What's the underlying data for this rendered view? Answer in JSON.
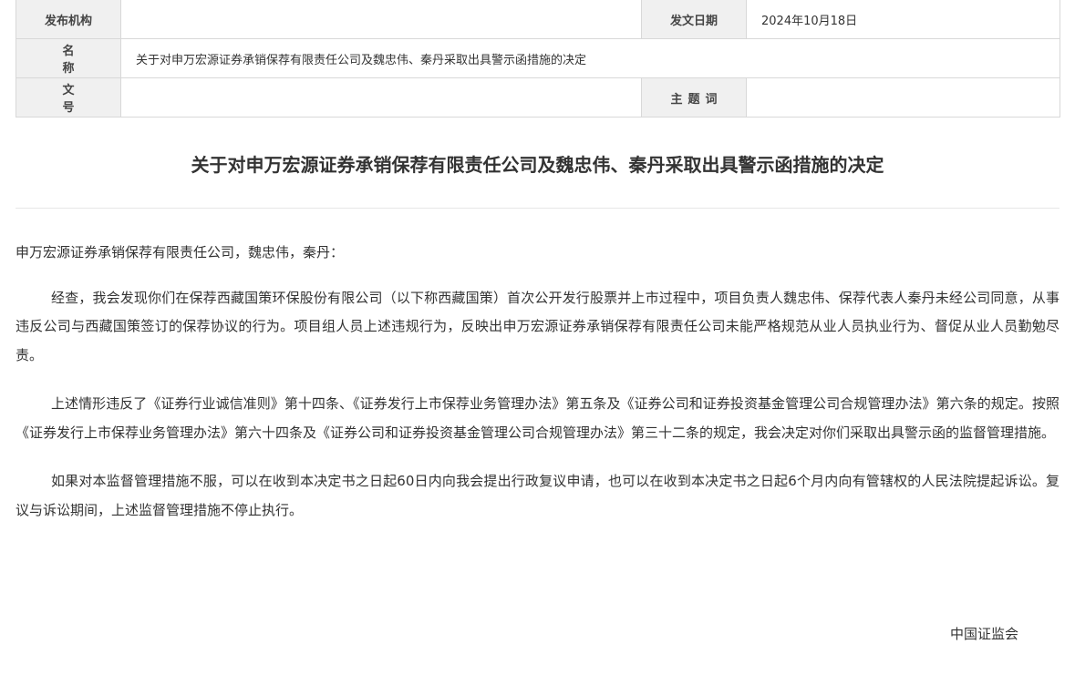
{
  "meta": {
    "publisher_label": "发布机构",
    "publisher_value": "",
    "date_label": "发文日期",
    "date_value": "2024年10月18日",
    "name_label": "名　称",
    "name_value": "关于对申万宏源证券承销保荐有限责任公司及魏忠伟、秦丹采取出具警示函措施的决定",
    "docno_label": "文　号",
    "docno_value": "",
    "keywords_label": "主题词",
    "keywords_value": ""
  },
  "document": {
    "title": "关于对申万宏源证券承销保荐有限责任公司及魏忠伟、秦丹采取出具警示函措施的决定",
    "salutation": "申万宏源证券承销保荐有限责任公司，魏忠伟，秦丹：",
    "paragraphs": [
      "经查，我会发现你们在保荐西藏国策环保股份有限公司（以下称西藏国策）首次公开发行股票并上市过程中，项目负责人魏忠伟、保荐代表人秦丹未经公司同意，从事违反公司与西藏国策签订的保荐协议的行为。项目组人员上述违规行为，反映出申万宏源证券承销保荐有限责任公司未能严格规范从业人员执业行为、督促从业人员勤勉尽责。",
      "上述情形违反了《证券行业诚信准则》第十四条、《证券发行上市保荐业务管理办法》第五条及《证券公司和证券投资基金管理公司合规管理办法》第六条的规定。按照《证券发行上市保荐业务管理办法》第六十四条及《证券公司和证券投资基金管理公司合规管理办法》第三十二条的规定，我会决定对你们采取出具警示函的监督管理措施。",
      "如果对本监督管理措施不服，可以在收到本决定书之日起60日内向我会提出行政复议申请，也可以在收到本决定书之日起6个月内向有管辖权的人民法院提起诉讼。复议与诉讼期间，上述监督管理措施不停止执行。"
    ],
    "signature": "中国证监会"
  }
}
